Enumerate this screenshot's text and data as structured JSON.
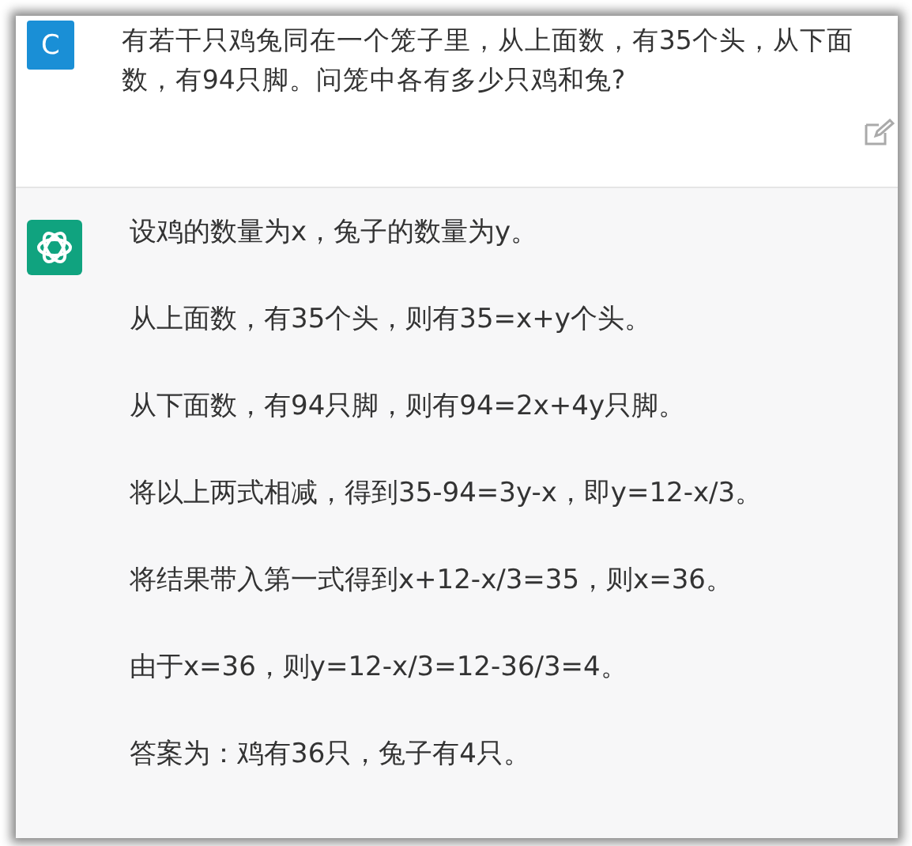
{
  "user_message": {
    "avatar_letter": "C",
    "text": "有若干只鸡兔同在一个笼子里，从上面数，有35个头，从下面数，有94只脚。问笼中各有多少只鸡和兔?"
  },
  "assistant_message": {
    "paragraphs": [
      "设鸡的数量为x，兔子的数量为y。",
      "从上面数，有35个头，则有35=x+y个头。",
      "从下面数，有94只脚，则有94=2x+4y只脚。",
      "将以上两式相减，得到35-94=3y-x，即y=12-x/3。",
      "将结果带入第一式得到x+12-x/3=35，则x=36。",
      "由于x=36，则y=12-x/3=12-36/3=4。",
      "答案为：鸡有36只，兔子有4只。"
    ]
  }
}
